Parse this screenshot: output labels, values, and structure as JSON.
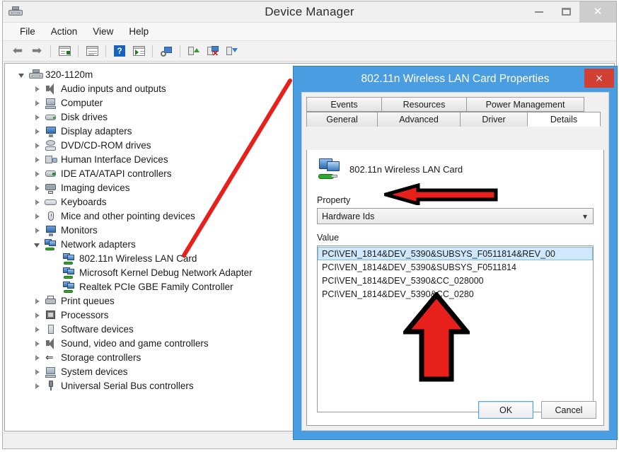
{
  "window": {
    "title": "Device Manager",
    "icon": "device-manager-icon",
    "controls": {
      "minimize": "–",
      "maximize": "❐",
      "close": "×"
    },
    "menus": [
      "File",
      "Action",
      "View",
      "Help"
    ],
    "toolbar": [
      {
        "name": "back-icon",
        "glyph": "←"
      },
      {
        "name": "forward-icon",
        "glyph": "→"
      },
      {
        "name": "show-hide-console-tree-icon",
        "glyph": ""
      },
      {
        "name": "properties-icon",
        "glyph": ""
      },
      {
        "name": "help-icon",
        "glyph": "?"
      },
      {
        "name": "scan-for-hardware-changes-icon",
        "glyph": ""
      },
      {
        "name": "update-driver-icon",
        "glyph": ""
      },
      {
        "name": "uninstall-device-icon",
        "glyph": ""
      },
      {
        "name": "disable-device-icon",
        "glyph": ""
      }
    ]
  },
  "tree": {
    "root": {
      "label": "320-1120m",
      "icon": "computer-root-icon",
      "state": "expanded"
    },
    "items": [
      {
        "label": "Audio inputs and outputs",
        "icon": "speaker-icon",
        "level": 1,
        "state": "collapsed"
      },
      {
        "label": "Computer",
        "icon": "computer-icon",
        "level": 1,
        "state": "collapsed"
      },
      {
        "label": "Disk drives",
        "icon": "disk-drive-icon",
        "level": 1,
        "state": "collapsed"
      },
      {
        "label": "Display adapters",
        "icon": "display-adapter-icon",
        "level": 1,
        "state": "collapsed"
      },
      {
        "label": "DVD/CD-ROM drives",
        "icon": "dvd-drive-icon",
        "level": 1,
        "state": "collapsed"
      },
      {
        "label": "Human Interface Devices",
        "icon": "hid-icon",
        "level": 1,
        "state": "collapsed"
      },
      {
        "label": "IDE ATA/ATAPI controllers",
        "icon": "ide-controller-icon",
        "level": 1,
        "state": "collapsed"
      },
      {
        "label": "Imaging devices",
        "icon": "imaging-device-icon",
        "level": 1,
        "state": "collapsed"
      },
      {
        "label": "Keyboards",
        "icon": "keyboard-icon",
        "level": 1,
        "state": "collapsed"
      },
      {
        "label": "Mice and other pointing devices",
        "icon": "mouse-icon",
        "level": 1,
        "state": "collapsed"
      },
      {
        "label": "Monitors",
        "icon": "monitor-icon",
        "level": 1,
        "state": "collapsed"
      },
      {
        "label": "Network adapters",
        "icon": "network-adapter-icon",
        "level": 1,
        "state": "expanded"
      },
      {
        "label": "802.11n Wireless LAN Card",
        "icon": "network-adapter-icon",
        "level": 2,
        "state": "none"
      },
      {
        "label": "Microsoft Kernel Debug Network Adapter",
        "icon": "network-adapter-icon",
        "level": 2,
        "state": "none"
      },
      {
        "label": "Realtek PCIe GBE Family Controller",
        "icon": "network-adapter-icon",
        "level": 2,
        "state": "none"
      },
      {
        "label": "Print queues",
        "icon": "printer-icon",
        "level": 1,
        "state": "collapsed"
      },
      {
        "label": "Processors",
        "icon": "processor-icon",
        "level": 1,
        "state": "collapsed"
      },
      {
        "label": "Software devices",
        "icon": "software-device-icon",
        "level": 1,
        "state": "collapsed"
      },
      {
        "label": "Sound, video and game controllers",
        "icon": "speaker-icon",
        "level": 1,
        "state": "collapsed"
      },
      {
        "label": "Storage controllers",
        "icon": "storage-controller-icon",
        "level": 1,
        "state": "collapsed"
      },
      {
        "label": "System devices",
        "icon": "computer-icon",
        "level": 1,
        "state": "collapsed"
      },
      {
        "label": "Universal Serial Bus controllers",
        "icon": "usb-controller-icon",
        "level": 1,
        "state": "collapsed"
      }
    ]
  },
  "dialog": {
    "title": "802.11n Wireless LAN Card Properties",
    "close_label": "×",
    "tabs_top": [
      "Events",
      "Resources",
      "Power Management"
    ],
    "tabs_bottom": [
      "General",
      "Advanced",
      "Driver",
      "Details"
    ],
    "selected_tab": "Details",
    "device_name": "802.11n Wireless LAN Card",
    "device_icon": "network-adapter-icon",
    "property_label": "Property",
    "property_value": "Hardware Ids",
    "value_label": "Value",
    "values": [
      "PCI\\VEN_1814&DEV_5390&SUBSYS_F0511814&REV_00",
      "PCI\\VEN_1814&DEV_5390&SUBSYS_F0511814",
      "PCI\\VEN_1814&DEV_5390&CC_028000",
      "PCI\\VEN_1814&DEV_5390&CC_0280"
    ],
    "selected_value_index": 0,
    "buttons": {
      "ok": "OK",
      "cancel": "Cancel"
    }
  },
  "annotations": {
    "line_color": "#e8201c",
    "arrow_fill": "#e8201c",
    "arrow_outline": "#000000",
    "items": [
      {
        "name": "pointer-line-to-wireless-card",
        "type": "line"
      },
      {
        "name": "left-arrow-to-hardware-ids",
        "type": "arrow-left"
      },
      {
        "name": "up-arrow-to-hardware-id-values",
        "type": "arrow-up"
      }
    ]
  }
}
